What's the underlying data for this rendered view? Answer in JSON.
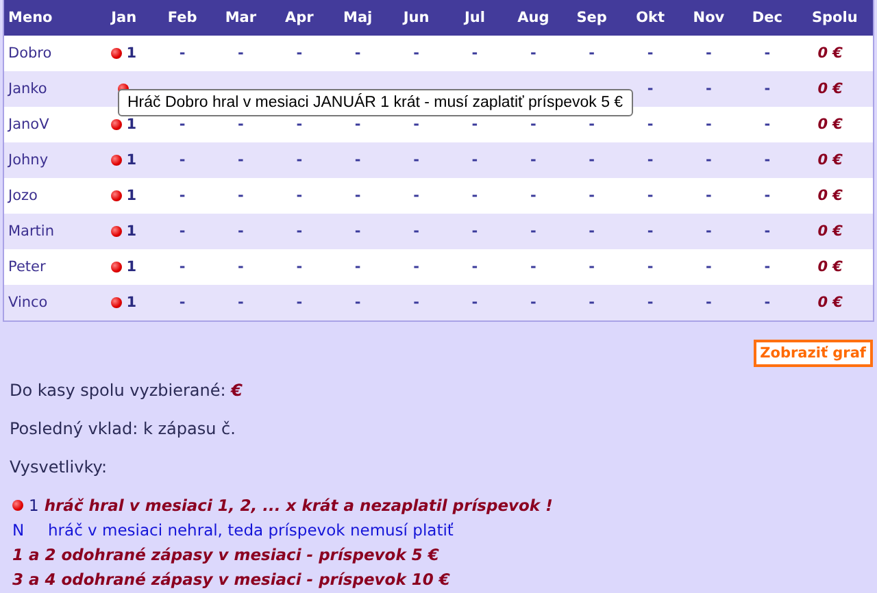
{
  "table": {
    "columns": [
      "Meno",
      "Jan",
      "Feb",
      "Mar",
      "Apr",
      "Maj",
      "Jun",
      "Jul",
      "Aug",
      "Sep",
      "Okt",
      "Nov",
      "Dec",
      "Spolu"
    ],
    "rows": [
      {
        "name": "Dobro",
        "months": [
          {
            "kind": "played",
            "count": "1"
          },
          "-",
          "-",
          "-",
          "-",
          "-",
          "-",
          "-",
          "-",
          "-",
          "-",
          "-"
        ],
        "total": "0 €"
      },
      {
        "name": "Janko",
        "months": [
          {
            "kind": "played"
          },
          {
            "kind": "covered"
          },
          {
            "kind": "covered"
          },
          {
            "kind": "covered"
          },
          {
            "kind": "covered"
          },
          {
            "kind": "covered"
          },
          {
            "kind": "covered"
          },
          {
            "kind": "covered"
          },
          {
            "kind": "covered"
          },
          "-",
          "-",
          "-"
        ],
        "total": "0 €"
      },
      {
        "name": "JanoV",
        "months": [
          {
            "kind": "played",
            "count": "1"
          },
          "-",
          "-",
          "-",
          "-",
          "-",
          "-",
          "-",
          "-",
          "-",
          "-",
          "-"
        ],
        "total": "0 €"
      },
      {
        "name": "Johny",
        "months": [
          {
            "kind": "played",
            "count": "1"
          },
          "-",
          "-",
          "-",
          "-",
          "-",
          "-",
          "-",
          "-",
          "-",
          "-",
          "-"
        ],
        "total": "0 €"
      },
      {
        "name": "Jozo",
        "months": [
          {
            "kind": "played",
            "count": "1"
          },
          "-",
          "-",
          "-",
          "-",
          "-",
          "-",
          "-",
          "-",
          "-",
          "-",
          "-"
        ],
        "total": "0 €"
      },
      {
        "name": "Martin",
        "months": [
          {
            "kind": "played",
            "count": "1"
          },
          "-",
          "-",
          "-",
          "-",
          "-",
          "-",
          "-",
          "-",
          "-",
          "-",
          "-"
        ],
        "total": "0 €"
      },
      {
        "name": "Peter",
        "months": [
          {
            "kind": "played",
            "count": "1"
          },
          "-",
          "-",
          "-",
          "-",
          "-",
          "-",
          "-",
          "-",
          "-",
          "-",
          "-"
        ],
        "total": "0 €"
      },
      {
        "name": "Vinco",
        "months": [
          {
            "kind": "played",
            "count": "1"
          },
          "-",
          "-",
          "-",
          "-",
          "-",
          "-",
          "-",
          "-",
          "-",
          "-",
          "-"
        ],
        "total": "0 €"
      }
    ]
  },
  "tooltip": "Hráč Dobro hral v mesiaci JANUÁR 1 krát - musí zaplatiť príspevok 5 €",
  "graph_button": "Zobraziť graf",
  "collected": {
    "label": "Do kasy spolu vyzbierané:",
    "amount": "€"
  },
  "last_deposit": "Posledný vklad: k zápasu č.",
  "legend_title": "Vysvetlivky:",
  "legend": [
    {
      "kind": "dot",
      "symbol": "1",
      "text": "hráč hral v mesiaci 1, 2, ... x krát a nezaplatil príspevok !"
    },
    {
      "kind": "letter",
      "symbol": "N",
      "text": "hráč v mesiaci nehral, teda príspevok nemusí platiť"
    },
    {
      "kind": "rule",
      "text": "1 a 2 odohrané zápasy v mesiaci - príspevok 5 €"
    },
    {
      "kind": "rule",
      "text": "3 a 4 odohrané zápasy v mesiaci - príspevok 10 €"
    }
  ]
}
